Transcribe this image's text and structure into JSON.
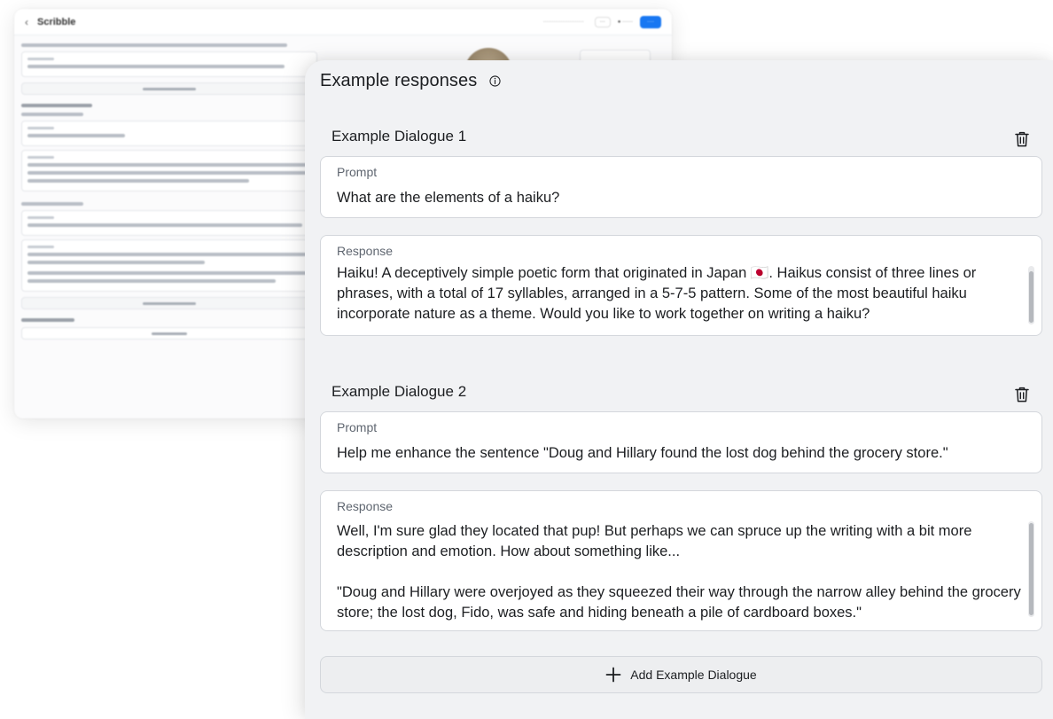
{
  "background_window": {
    "title": "Scribble"
  },
  "panel": {
    "title": "Example responses",
    "add_dialogue_label": "Add Example Dialogue"
  },
  "dialogues": [
    {
      "title": "Example Dialogue 1",
      "prompt_label": "Prompt",
      "prompt": "What are the elements of a haiku?",
      "response_label": "Response",
      "response": "Haiku! A deceptively simple poetic form that originated in Japan 🇯🇵. Haikus consist of three lines or phrases, with a total of 17 syllables, arranged in a 5-7-5 pattern. Some of the most beautiful haiku incorporate nature as a theme. Would you like to work together on writing a haiku?"
    },
    {
      "title": "Example Dialogue 2",
      "prompt_label": "Prompt",
      "prompt": "Help me enhance the sentence \"Doug and Hillary found the lost dog behind the grocery store.\"",
      "response_label": "Response",
      "response": "Well, I'm sure glad they located that pup! But perhaps we can spruce up the writing with a bit more description and emotion. How about something like...\n\n\"Doug and Hillary were overjoyed as they squeezed their way through the narrow alley behind the grocery store; the lost dog, Fido, was safe and hiding beneath a pile of cardboard boxes.\""
    }
  ],
  "colors": {
    "panel_bg": "#f1f2f4",
    "field_bg": "#ffffff",
    "border": "#d4d7dc",
    "accent": "#1877f2"
  },
  "icons": {
    "info": "info-icon",
    "trash": "trash-icon",
    "plus": "plus-icon"
  }
}
